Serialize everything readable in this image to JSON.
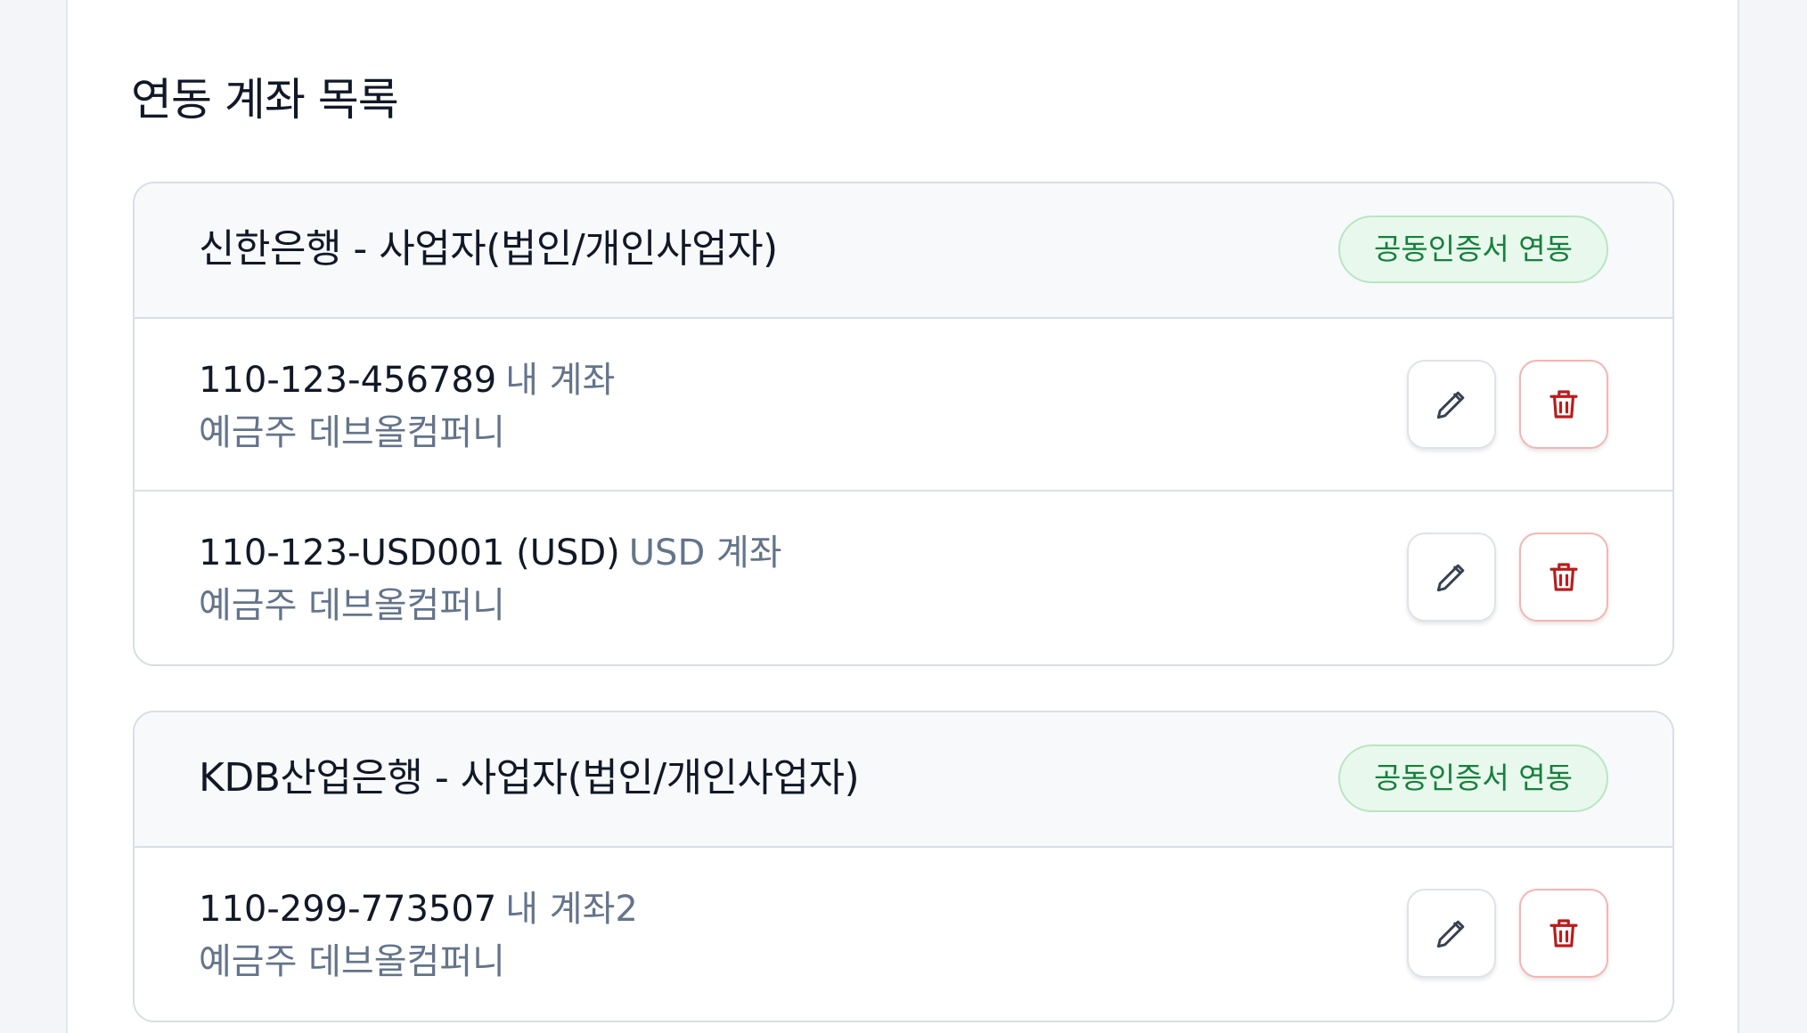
{
  "section": {
    "title": "연동 계좌 목록"
  },
  "banks": [
    {
      "name": "신한은행 - 사업자(법인/개인사업자)",
      "badge": "공동인증서 연동",
      "accounts": [
        {
          "number": "110-123-456789",
          "alias": "내 계좌",
          "holder": "예금주 데브올컴퍼니"
        },
        {
          "number": "110-123-USD001 (USD)",
          "alias": "USD 계좌",
          "holder": "예금주 데브올컴퍼니"
        }
      ]
    },
    {
      "name": "KDB산업은행 - 사업자(법인/개인사업자)",
      "badge": "공동인증서 연동",
      "accounts": [
        {
          "number": "110-299-773507",
          "alias": "내 계좌2",
          "holder": "예금주 데브올컴퍼니"
        }
      ]
    }
  ],
  "icons": {
    "edit": "pencil-icon",
    "delete": "trash-icon"
  },
  "colors": {
    "badge_text": "#15803d",
    "badge_background": "#e9f8ec",
    "badge_border": "#b8e6c2",
    "delete_icon": "#b91c1c",
    "delete_border": "#f3b6b2",
    "muted_text": "#64748b"
  }
}
